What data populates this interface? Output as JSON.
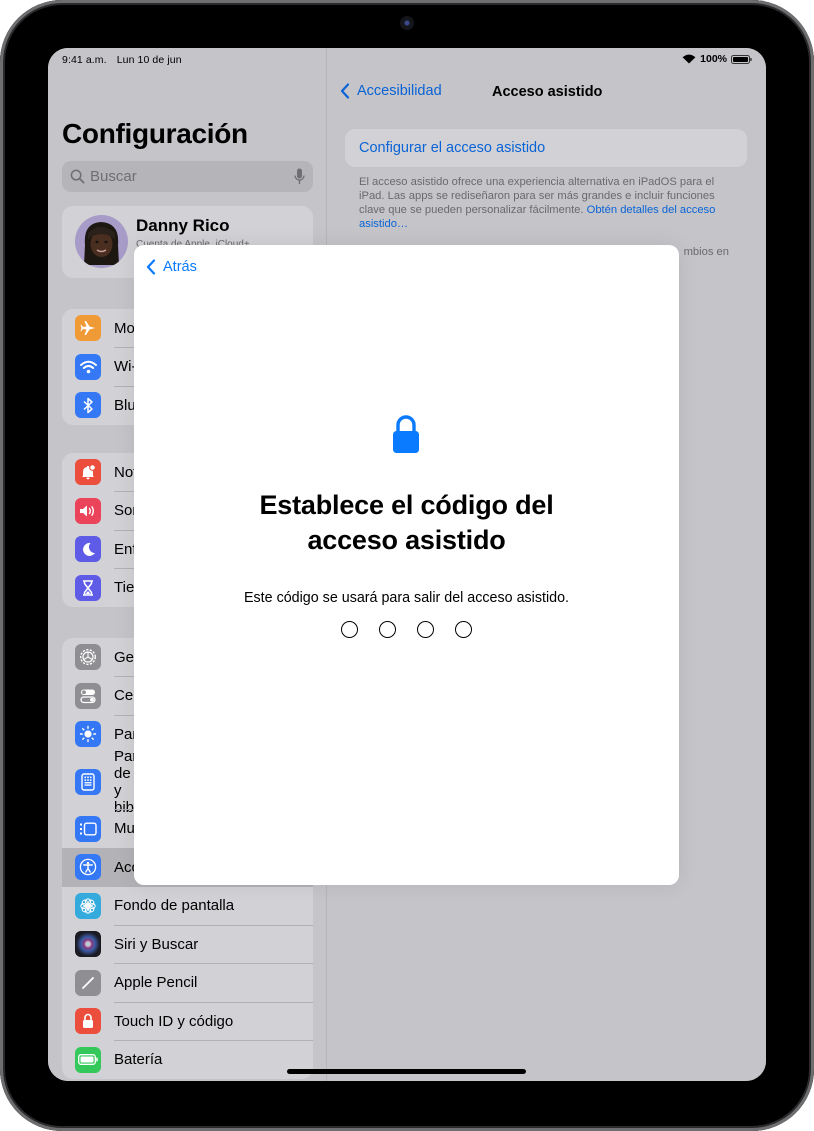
{
  "status_bar": {
    "time": "9:41 a.m.",
    "date": "Lun 10 de jun",
    "battery_percent": "100%",
    "battery_level": 1.0
  },
  "sidebar": {
    "title": "Configuración",
    "search": {
      "placeholder": "Buscar"
    },
    "profile": {
      "name": "Danny Rico",
      "subtitle": "Cuenta de Apple, iCloud+"
    },
    "groups": [
      [
        {
          "id": "airplane",
          "label": "Modo Avión",
          "icon": "airplane-icon",
          "color": "#f09a37"
        },
        {
          "id": "wifi",
          "label": "Wi-Fi",
          "icon": "wifi-icon",
          "color": "#3478f6"
        },
        {
          "id": "bluetooth",
          "label": "Bluetooth",
          "icon": "bluetooth-icon",
          "color": "#3478f6"
        }
      ],
      [
        {
          "id": "notifications",
          "label": "Notificaciones",
          "icon": "bell-icon",
          "color": "#eb4e3d"
        },
        {
          "id": "sounds",
          "label": "Sonidos",
          "icon": "speaker-icon",
          "color": "#eb445a"
        },
        {
          "id": "focus",
          "label": "Enfoque",
          "icon": "moon-icon",
          "color": "#5e5ce6"
        },
        {
          "id": "screen-time",
          "label": "Tiempo en pantalla",
          "icon": "hourglass-icon",
          "color": "#5e5ce6"
        }
      ],
      [
        {
          "id": "general",
          "label": "General",
          "icon": "gear-icon",
          "color": "#8e8e93"
        },
        {
          "id": "control-center",
          "label": "Centro de control",
          "icon": "toggles-icon",
          "color": "#8e8e93"
        },
        {
          "id": "display",
          "label": "Pantalla y brillo",
          "icon": "sun-icon",
          "color": "#3478f6"
        },
        {
          "id": "home-screen",
          "label": "Pantalla de inicio y biblioteca",
          "icon": "home-screen-icon",
          "color": "#3478f6"
        },
        {
          "id": "multitasking",
          "label": "Multitarea y gestos",
          "icon": "multitasking-icon",
          "color": "#3478f6"
        },
        {
          "id": "accessibility",
          "label": "Accesibilidad",
          "icon": "accessibility-icon",
          "color": "#3478f6",
          "selected": true
        },
        {
          "id": "wallpaper",
          "label": "Fondo de pantalla",
          "icon": "flower-icon",
          "color": "#35aadc"
        },
        {
          "id": "siri",
          "label": "Siri y Buscar",
          "icon": "siri-icon",
          "color": "#1c1c1e"
        },
        {
          "id": "pencil",
          "label": "Apple Pencil",
          "icon": "pencil-icon",
          "color": "#8e8e93"
        },
        {
          "id": "touchid",
          "label": "Touch ID y código",
          "icon": "lock-icon",
          "color": "#eb4e3d"
        },
        {
          "id": "battery",
          "label": "Batería",
          "icon": "battery-icon",
          "color": "#34c759"
        }
      ]
    ]
  },
  "detail": {
    "back_label": "Accesibilidad",
    "title": "Acceso asistido",
    "configure_label": "Configurar el acceso asistido",
    "description": "El acceso asistido ofrece una experiencia alternativa en iPadOS para el iPad. Las apps se rediseñaron para ser más grandes e incluir funciones clave que se pueden personalizar fácilmente. ",
    "description_link": "Obtén detalles del acceso asistido…",
    "description2_visible": "mbios en"
  },
  "modal": {
    "back_label": "Atrás",
    "icon": "lock-icon",
    "title_line1": "Establece el código del",
    "title_line2": "acceso asistido",
    "message": "Este código se usará para salir del acceso asistido.",
    "passcode_length": 4,
    "passcode_entered": 0
  },
  "colors": {
    "accent": "#0a7aff",
    "link": "#0a63d6"
  }
}
